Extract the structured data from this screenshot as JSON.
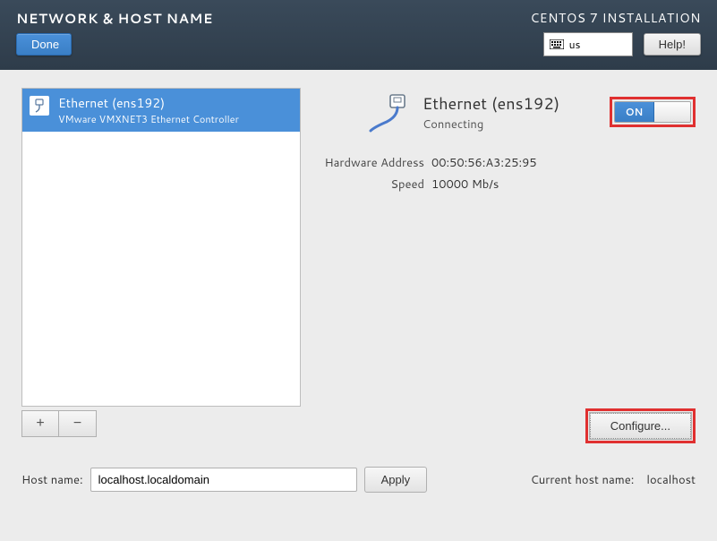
{
  "header": {
    "title": "NETWORK & HOST NAME",
    "done_label": "Done",
    "install_title": "CENTOS 7 INSTALLATION",
    "keyboard_layout": "us",
    "help_label": "Help!"
  },
  "interface_list": {
    "items": [
      {
        "name": "Ethernet (ens192)",
        "subtitle": "VMware VMXNET3 Ethernet Controller"
      }
    ],
    "add_label": "+",
    "remove_label": "−"
  },
  "detail": {
    "name": "Ethernet (ens192)",
    "status": "Connecting",
    "toggle_on_label": "ON",
    "hw_label": "Hardware Address",
    "hw_value": "00:50:56:A3:25:95",
    "speed_label": "Speed",
    "speed_value": "10000 Mb/s",
    "configure_label": "Configure..."
  },
  "hostname": {
    "label": "Host name:",
    "value": "localhost.localdomain",
    "apply_label": "Apply",
    "current_label": "Current host name:",
    "current_value": "localhost"
  }
}
